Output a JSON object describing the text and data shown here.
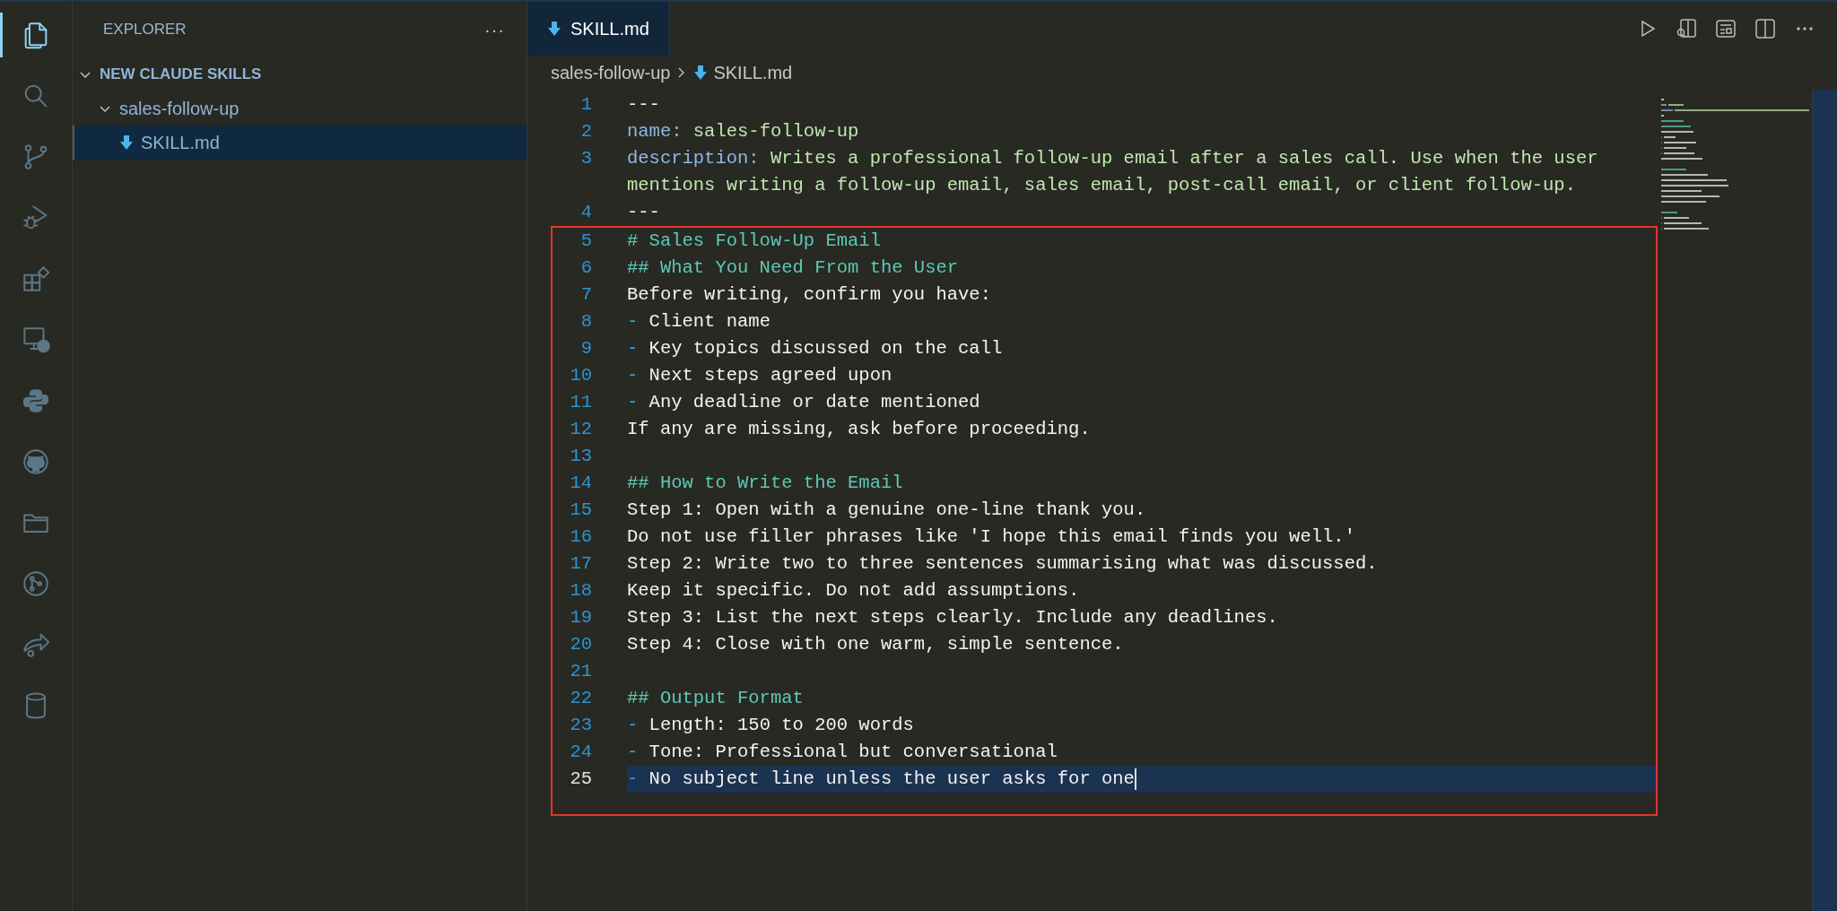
{
  "activity_bar": [
    {
      "selected": true
    },
    {
      "selected": false
    },
    {
      "selected": false
    },
    {
      "selected": false
    },
    {
      "selected": false
    },
    {
      "selected": false
    },
    {
      "selected": false
    },
    {
      "selected": false
    },
    {
      "selected": false
    },
    {
      "selected": false
    },
    {
      "selected": false
    },
    {
      "selected": false
    }
  ],
  "sidebar": {
    "title": "EXPLORER",
    "more": "···",
    "tree": [
      {
        "label": "NEW CLAUDE SKILLS",
        "kind": "root",
        "expanded": true,
        "selected": false,
        "children": [
          {
            "label": "sales-follow-up",
            "kind": "folder",
            "expanded": true,
            "selected": false,
            "children": [
              {
                "label": "SKILL.md",
                "kind": "file",
                "selected": true
              }
            ]
          }
        ]
      }
    ]
  },
  "tabs": [
    {
      "label": "SKILL.md",
      "selected": true
    }
  ],
  "breadcrumb": [
    "sales-follow-up",
    "SKILL.md"
  ],
  "editor": {
    "lines": [
      {
        "number": "1",
        "current": false,
        "tokens": [
          {
            "kind": "plain",
            "text": "---"
          }
        ]
      },
      {
        "number": "2",
        "current": false,
        "tokens": [
          {
            "kind": "key",
            "text": "name:"
          },
          {
            "kind": "value",
            "text": " sales-follow-up"
          }
        ]
      },
      {
        "number": "3",
        "current": false,
        "tokens": [
          {
            "kind": "key",
            "text": "description:"
          },
          {
            "kind": "value",
            "text": " Writes a professional follow-up email after a sales call. Use when the user mentions writing a follow-up email, sales email, post-call email, or client follow-up."
          }
        ]
      },
      {
        "number": "4",
        "current": false,
        "tokens": [
          {
            "kind": "plain",
            "text": "---"
          }
        ]
      }
    ],
    "highlight_box": {
      "lines": [
        {
          "number": "5",
          "current": false,
          "tokens": [
            {
              "kind": "heading",
              "text": "# Sales Follow-Up Email"
            }
          ]
        },
        {
          "number": "6",
          "current": false,
          "tokens": [
            {
              "kind": "heading",
              "text": "## What You Need From the User"
            }
          ]
        },
        {
          "number": "7",
          "current": false,
          "tokens": [
            {
              "kind": "plain",
              "text": "Before writing, confirm you have:"
            }
          ]
        },
        {
          "number": "8",
          "current": false,
          "tokens": [
            {
              "kind": "bullet",
              "text": "-"
            },
            {
              "kind": "plain",
              "text": " Client name"
            }
          ]
        },
        {
          "number": "9",
          "current": false,
          "tokens": [
            {
              "kind": "bullet",
              "text": "-"
            },
            {
              "kind": "plain",
              "text": " Key topics discussed on the call"
            }
          ]
        },
        {
          "number": "10",
          "current": false,
          "tokens": [
            {
              "kind": "bullet",
              "text": "-"
            },
            {
              "kind": "plain",
              "text": " Next steps agreed upon"
            }
          ]
        },
        {
          "number": "11",
          "current": false,
          "tokens": [
            {
              "kind": "bullet",
              "text": "-"
            },
            {
              "kind": "plain",
              "text": " Any deadline or date mentioned"
            }
          ]
        },
        {
          "number": "12",
          "current": false,
          "tokens": [
            {
              "kind": "plain",
              "text": "If any are missing, ask before proceeding."
            }
          ]
        },
        {
          "number": "13",
          "current": false
        },
        {
          "number": "14",
          "current": false,
          "tokens": [
            {
              "kind": "heading",
              "text": "## How to Write the Email"
            }
          ]
        },
        {
          "number": "15",
          "current": false,
          "tokens": [
            {
              "kind": "plain",
              "text": "Step 1: Open with a genuine one-line thank you."
            }
          ]
        },
        {
          "number": "16",
          "current": false,
          "tokens": [
            {
              "kind": "plain",
              "text": "Do not use filler phrases like 'I hope this email finds you well.'"
            }
          ]
        },
        {
          "number": "17",
          "current": false,
          "tokens": [
            {
              "kind": "plain",
              "text": "Step 2: Write two to three sentences summarising what was discussed."
            }
          ]
        },
        {
          "number": "18",
          "current": false,
          "tokens": [
            {
              "kind": "plain",
              "text": "Keep it specific. Do not add assumptions."
            }
          ]
        },
        {
          "number": "19",
          "current": false,
          "tokens": [
            {
              "kind": "plain",
              "text": "Step 3: List the next steps clearly. Include any deadlines."
            }
          ]
        },
        {
          "number": "20",
          "current": false,
          "tokens": [
            {
              "kind": "plain",
              "text": "Step 4: Close with one warm, simple sentence."
            }
          ]
        },
        {
          "number": "21",
          "current": false
        },
        {
          "number": "22",
          "current": false,
          "tokens": [
            {
              "kind": "heading",
              "text": "## Output Format"
            }
          ]
        },
        {
          "number": "23",
          "current": false,
          "tokens": [
            {
              "kind": "bullet",
              "text": "-"
            },
            {
              "kind": "plain",
              "text": " Length: 150 to 200 words"
            }
          ]
        },
        {
          "number": "24",
          "current": false,
          "tokens": [
            {
              "kind": "bullet",
              "text": "-"
            },
            {
              "kind": "plain",
              "text": " Tone: Professional but conversational"
            }
          ]
        },
        {
          "number": "25",
          "current": true,
          "tokens": [
            {
              "kind": "bullet",
              "text": "-"
            },
            {
              "kind": "plain",
              "text": " No subject line unless the user asks for one"
            }
          ]
        }
      ]
    }
  }
}
